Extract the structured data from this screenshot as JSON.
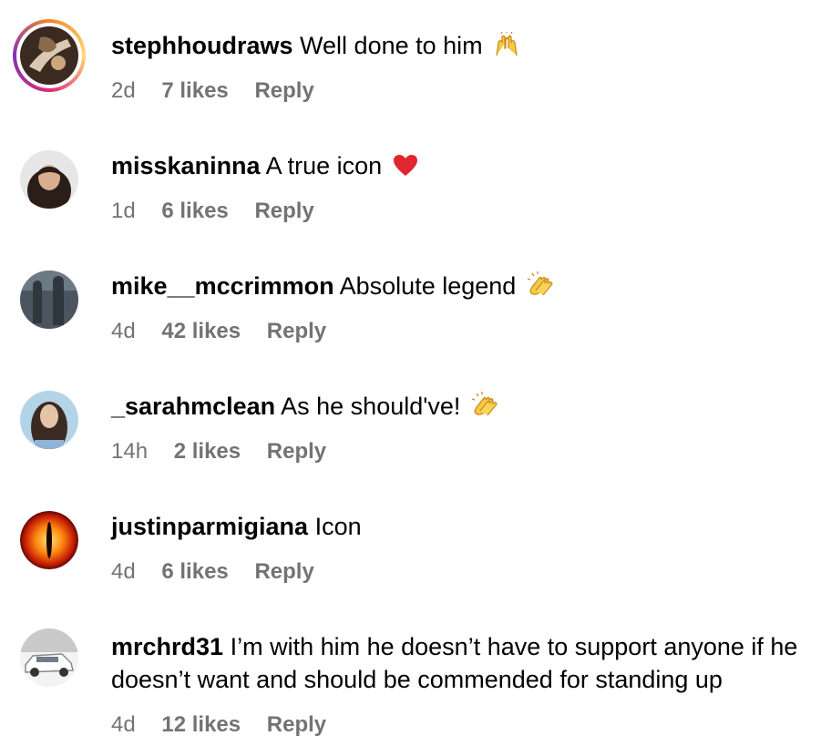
{
  "comments": [
    {
      "username": "stephhoudraws",
      "text": "Well done to him",
      "emoji": "raising-hands",
      "time": "2d",
      "likes": "7 likes",
      "reply": "Reply",
      "avatar": {
        "style": "story-ring",
        "colors": [
          "#3a2a20",
          "#d8c9b0"
        ]
      }
    },
    {
      "username": "misskaninna",
      "text": "A true icon",
      "emoji": "red-heart",
      "time": "1d",
      "likes": "6 likes",
      "reply": "Reply",
      "avatar": {
        "colors": [
          "#e6e6e6",
          "#2b1d17"
        ]
      }
    },
    {
      "username": "mike__mccrimmon",
      "text": "Absolute legend",
      "emoji": "clapping-hands",
      "time": "4d",
      "likes": "42 likes",
      "reply": "Reply",
      "avatar": {
        "colors": [
          "#4b5560",
          "#2f363d"
        ]
      }
    },
    {
      "username": "_sarahmclean",
      "text": "As he should've!",
      "emoji": "clapping-hands",
      "time": "14h",
      "likes": "2 likes",
      "reply": "Reply",
      "avatar": {
        "colors": [
          "#b3d3e6",
          "#3a2a22"
        ]
      }
    },
    {
      "username": "justinparmigiana",
      "text": "Icon",
      "emoji": "",
      "time": "4d",
      "likes": "6 likes",
      "reply": "Reply",
      "avatar": {
        "colors": [
          "#c41a05",
          "#ffb21e"
        ]
      }
    },
    {
      "username": "mrchrd31",
      "text": "I’m with him he doesn’t have to support anyone if he doesn’t want and should be commended for standing up",
      "emoji": "",
      "time": "4d",
      "likes": "12 likes",
      "reply": "Reply",
      "avatar": {
        "colors": [
          "#c9c9c9",
          "#f3f3f3"
        ]
      }
    }
  ],
  "colors": {
    "text": "#000000",
    "meta": "#737373",
    "background": "#ffffff"
  }
}
